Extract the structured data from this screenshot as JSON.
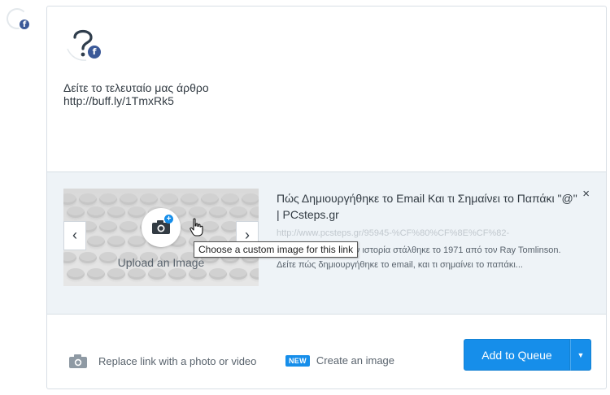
{
  "profile": {
    "network_icon": "facebook-f",
    "badge_letter": "f",
    "brand_color": "#3b5998"
  },
  "post": {
    "lines": [
      "Δείτε το τελευταίο μας άρθρο",
      "http://buff.ly/1TmxRk5"
    ]
  },
  "attachment": {
    "upload_label": "Upload an Image",
    "tooltip": "Choose a custom image for this link",
    "prev_icon": "‹",
    "next_icon": "›",
    "close_icon": "×",
    "title": "Πώς Δημιουργήθηκε το Email Και τι Σημαίνει το Παπάκι \"@\" | PCsteps.gr",
    "url": "http://www.pcsteps.gr/95945-%CF%80%CF%8E%CF%82-",
    "description": "Το πρώτο email στην ιστορία στάλθηκε το 1971 από τον Ray Tomlinson. Δείτε πώς δημιουργήθηκε το email, και τι σημαίνει το παπάκι..."
  },
  "footer": {
    "replace_link": "Replace link with a photo or video",
    "new_badge": "NEW",
    "create_image": "Create an image",
    "queue_button": "Add to Queue",
    "dropdown_icon": "▼"
  },
  "colors": {
    "accent": "#168eea",
    "attachment_bg": "#eef3f7",
    "border": "#d8dfe5"
  }
}
